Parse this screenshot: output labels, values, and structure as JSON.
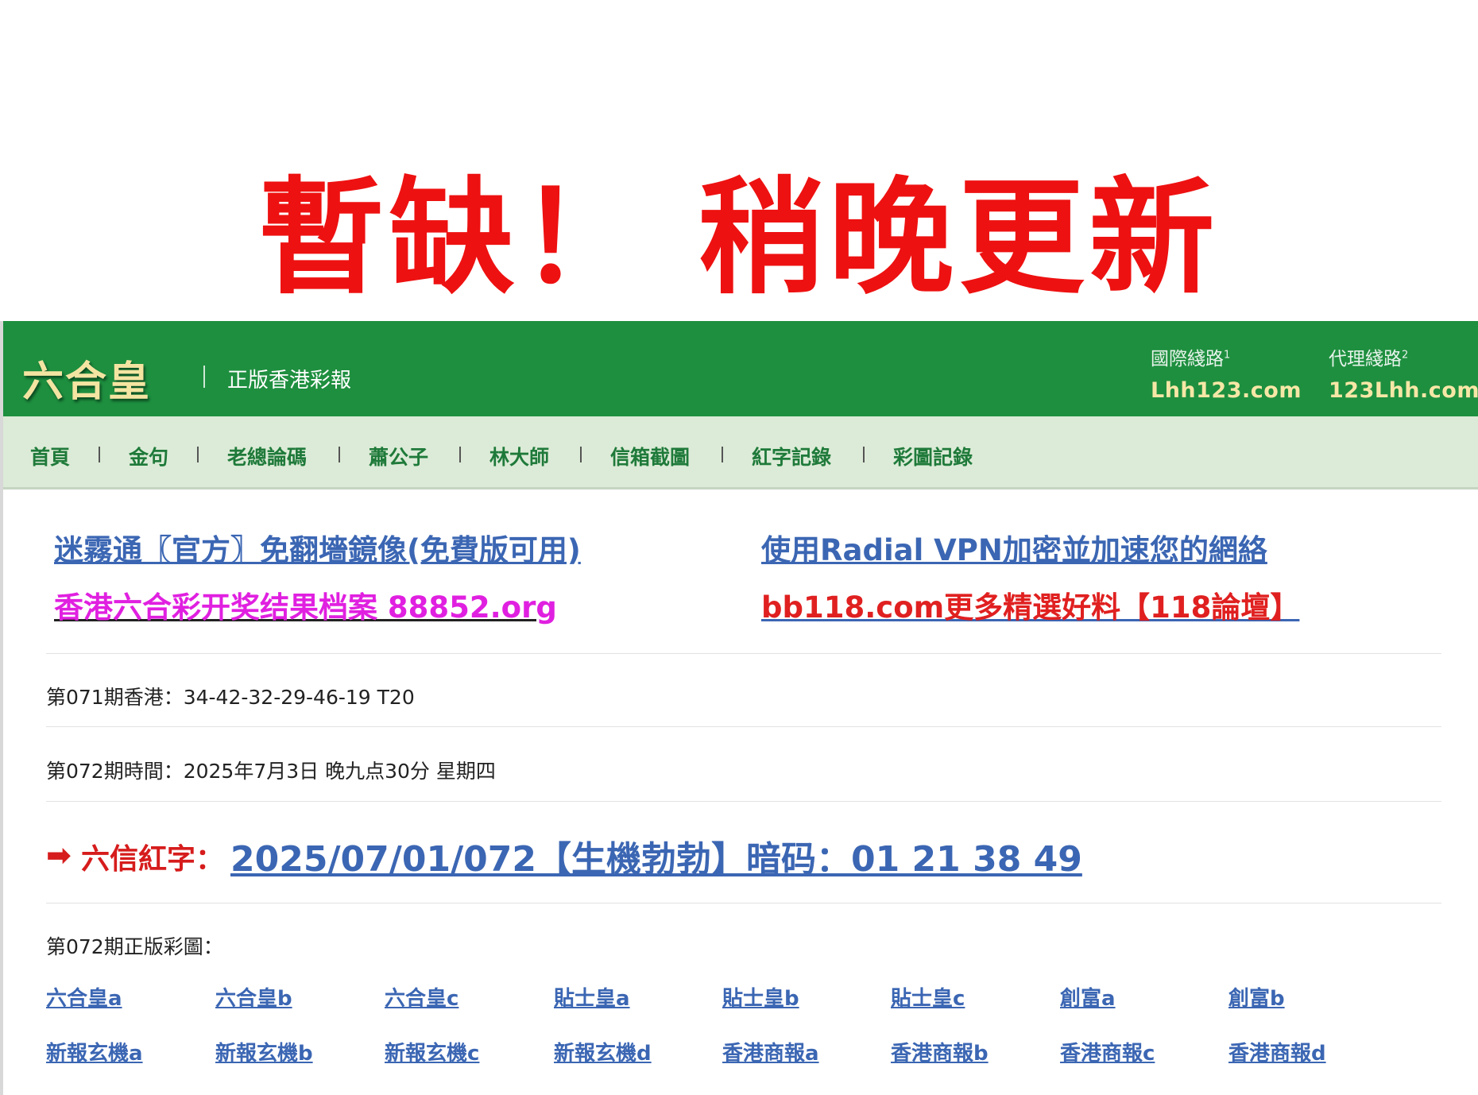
{
  "notice": "暫缺！ 稍晚更新",
  "header": {
    "logo": "六合皇",
    "tagline": "正版香港彩報",
    "routes": [
      {
        "label": "國際綫路",
        "num": "1",
        "url": "Lhh123.com"
      },
      {
        "label": "代理綫路",
        "num": "2",
        "url": "123Lhh.com"
      }
    ]
  },
  "nav": [
    "首頁",
    "金句",
    "老總論碼",
    "蕭公子",
    "林大師",
    "信箱截圖",
    "紅字記錄",
    "彩圖記錄"
  ],
  "promos": [
    "迷霧通〖官方〗免翻墻鏡像(免費版可用)",
    "使用Radial VPN加密並加速您的網絡",
    "香港六合彩开奖结果档案 88852.org",
    "bb118.com更多精選好料【118論壇】"
  ],
  "info": {
    "draw_result": "第071期香港：34-42-32-29-46-19 T20",
    "draw_time": "第072期時間：2025年7月3日 晚九点30分 星期四",
    "arrow": "➡",
    "red_label": "六信紅字：",
    "red_link": "2025/07/01/072【生機勃勃】暗码：01 21 38 49",
    "colour_title": "第072期正版彩圖："
  },
  "colour_links": {
    "row1": [
      "六合皇a",
      "六合皇b",
      "六合皇c",
      "貼士皇a",
      "貼士皇b",
      "貼士皇c",
      "創富a",
      "創富b"
    ],
    "row2": [
      "新報玄機a",
      "新報玄機b",
      "新報玄機c",
      "新報玄機d",
      "香港商報a",
      "香港商報b",
      "香港商報c",
      "香港商報d"
    ]
  },
  "colors": {
    "header_green": "#1e8f3f",
    "nav_bg": "#dcebd7",
    "link_blue": "#3b66b3",
    "notice_red": "#ee1111",
    "magenta": "#e020e0"
  }
}
